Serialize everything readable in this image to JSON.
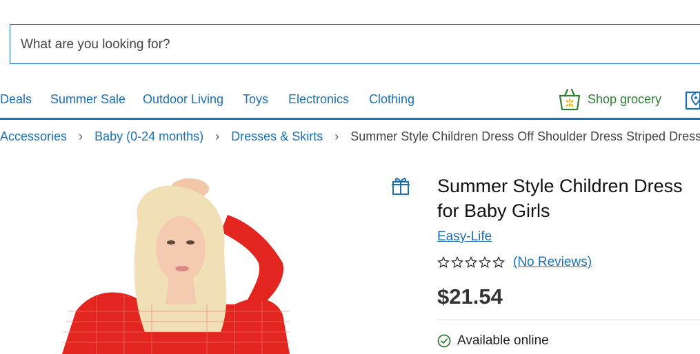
{
  "search": {
    "placeholder": "What are you looking for?"
  },
  "nav": {
    "items": [
      {
        "label": "Deals"
      },
      {
        "label": "Summer Sale"
      },
      {
        "label": "Outdoor Living"
      },
      {
        "label": "Toys"
      },
      {
        "label": "Electronics"
      },
      {
        "label": "Clothing"
      }
    ],
    "grocery_label": "Shop grocery"
  },
  "breadcrumb": {
    "items": [
      "Accessories",
      "Baby (0-24 months)",
      "Dresses & Skirts"
    ],
    "separator": "›",
    "current": "Summer Style Children Dress Off Shoulder Dress Striped Dresses for"
  },
  "product": {
    "title_line1": "Summer Style Children Dress",
    "title_line2": "for Baby Girls",
    "brand": "Easy-Life",
    "rating_stars": 0,
    "reviews_label": "(No Reviews)",
    "price": "$21.54",
    "availability": "Available online"
  },
  "colors": {
    "link": "#1a6fb5",
    "grocery": "#2e7d32",
    "available": "#2e7d32"
  },
  "icons": [
    "gift-icon",
    "grocery-basket-icon",
    "store-location-icon",
    "star-outline-icon",
    "check-circle-icon"
  ]
}
